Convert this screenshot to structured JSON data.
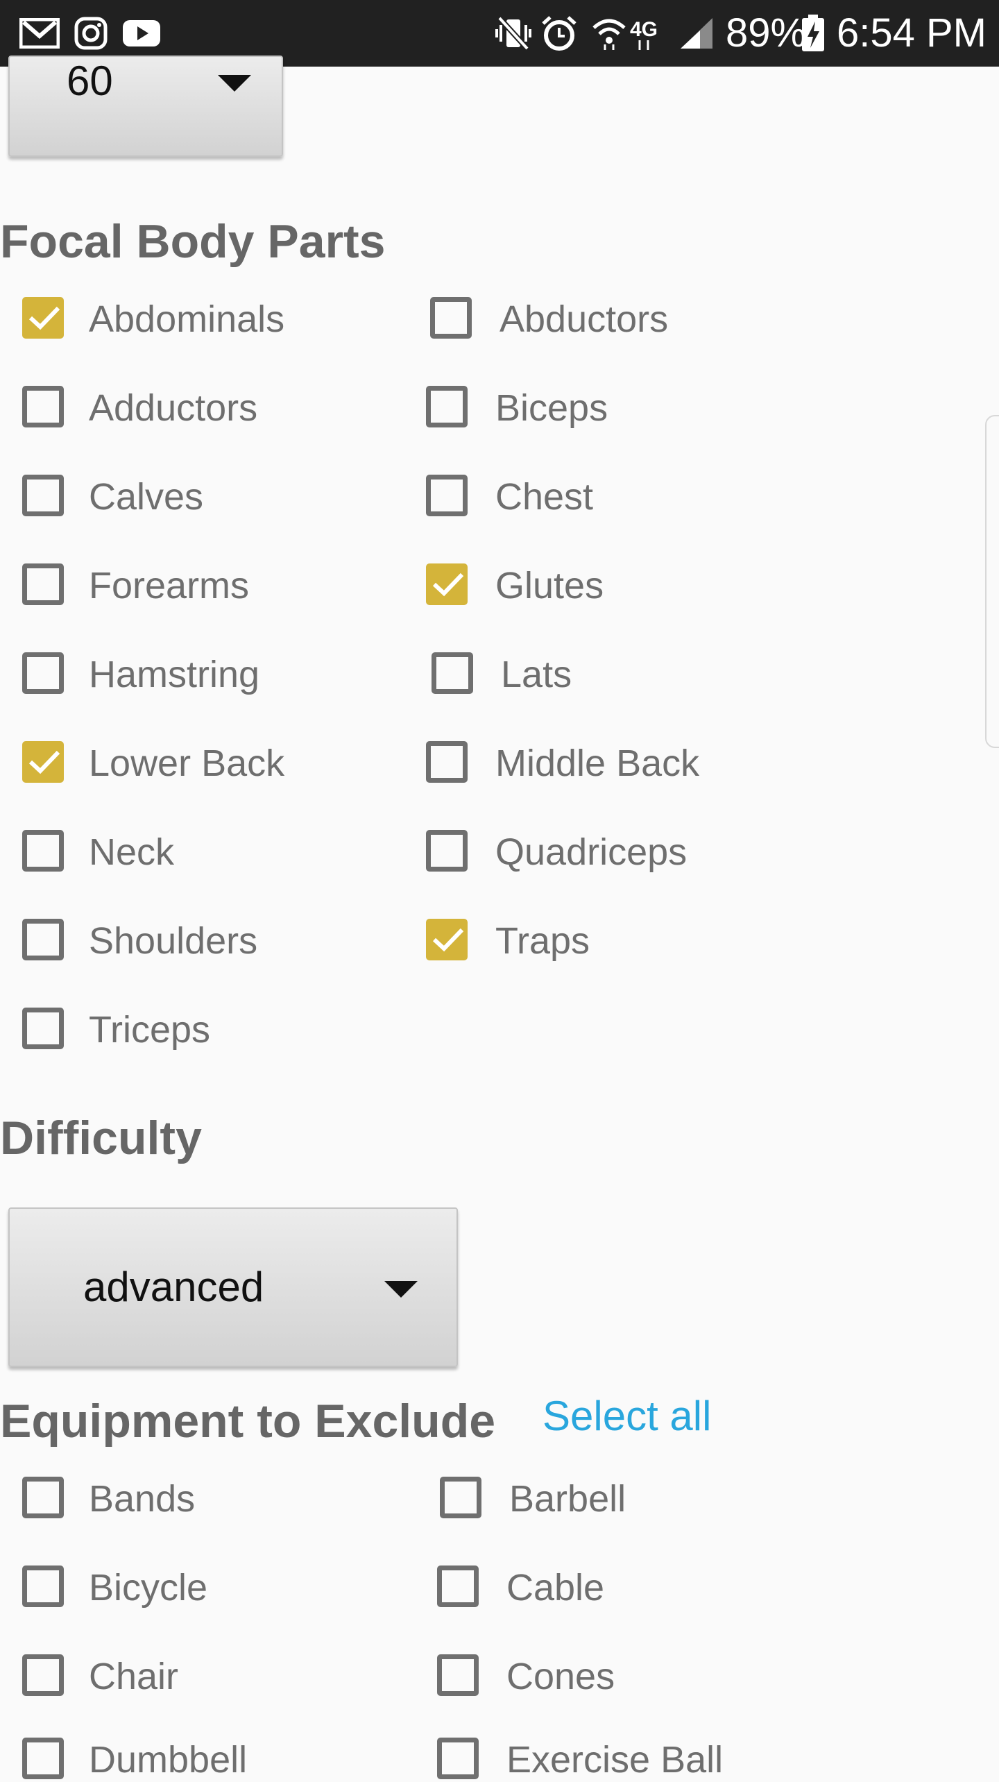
{
  "status_bar": {
    "battery": "89%",
    "time": "6:54 PM",
    "network": "4G",
    "icons": [
      "gmail-icon",
      "instagram-icon",
      "youtube-icon",
      "vibrate-mute-icon",
      "alarm-icon",
      "wifi-icon",
      "lte-icon",
      "signal-icon",
      "battery-charging-icon"
    ]
  },
  "top_spinner": {
    "value": "60"
  },
  "focal_body_parts": {
    "title": "Focal Body Parts",
    "items": [
      {
        "label": "Abdominals",
        "checked": true
      },
      {
        "label": "Abductors",
        "checked": false
      },
      {
        "label": "Adductors",
        "checked": false
      },
      {
        "label": "Biceps",
        "checked": false
      },
      {
        "label": "Calves",
        "checked": false
      },
      {
        "label": "Chest",
        "checked": false
      },
      {
        "label": "Forearms",
        "checked": false
      },
      {
        "label": "Glutes",
        "checked": true
      },
      {
        "label": "Hamstring",
        "checked": false
      },
      {
        "label": "Lats",
        "checked": false
      },
      {
        "label": "Lower Back",
        "checked": true
      },
      {
        "label": "Middle Back",
        "checked": false
      },
      {
        "label": "Neck",
        "checked": false
      },
      {
        "label": "Quadriceps",
        "checked": false
      },
      {
        "label": "Shoulders",
        "checked": false
      },
      {
        "label": "Traps",
        "checked": true
      },
      {
        "label": "Triceps",
        "checked": false
      }
    ]
  },
  "difficulty": {
    "title": "Difficulty",
    "value": "advanced"
  },
  "equipment": {
    "title": "Equipment to Exclude",
    "select_all": "Select all",
    "items": [
      {
        "label": "Bands",
        "checked": false
      },
      {
        "label": "Barbell",
        "checked": false
      },
      {
        "label": "Bicycle",
        "checked": false
      },
      {
        "label": "Cable",
        "checked": false
      },
      {
        "label": "Chair",
        "checked": false
      },
      {
        "label": "Cones",
        "checked": false
      },
      {
        "label": "Dumbbell",
        "checked": false
      },
      {
        "label": "Exercise Ball",
        "checked": false
      }
    ]
  },
  "colors": {
    "accent": "#d4b43a",
    "link": "#29a6dd",
    "text": "#6e6e6e",
    "status_bar": "#212121"
  }
}
